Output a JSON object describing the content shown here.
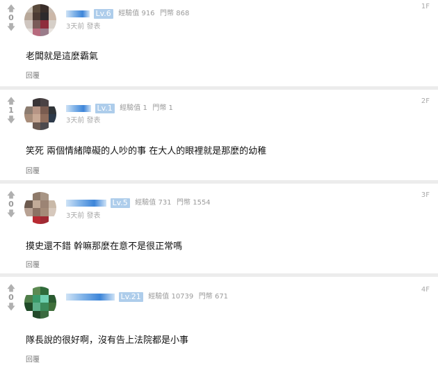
{
  "comments": [
    {
      "floor": "1F",
      "vote_count": "0",
      "level": "Lv.6",
      "exp": "經驗值 916",
      "coins": "門幣 868",
      "time": "3天前 發表",
      "text": "老闆就是這麼霸氣",
      "reply": "回覆",
      "avatar_colors": [
        "#c9c0b5",
        "#5a4a3c",
        "#3a2e2a",
        "#c7bbb0",
        "#b8a89a",
        "#4b3b33",
        "#2e2a2c",
        "#cbb7a8",
        "#cfc6c0",
        "#7a5b58",
        "#8e2d3c",
        "#d6cfc8",
        "#e4dfdb",
        "#b76a7d",
        "#9a7c8a",
        "#e9e4e0"
      ]
    },
    {
      "floor": "2F",
      "vote_count": "1",
      "level": "Lv.1",
      "exp": "經驗值 1",
      "coins": "門幣 1",
      "time": "3天前 發表",
      "text": "笑死 兩個情緒障礙的人吵的事 在大人的眼裡就是那麼的幼稚",
      "reply": "回覆",
      "avatar_colors": [
        "#ffffff",
        "#3a3537",
        "#4a4244",
        "#ffffff",
        "#8c7c70",
        "#b79585",
        "#7a5c50",
        "#303438",
        "#a88d7a",
        "#c8a995",
        "#8f6d5c",
        "#2d3a4a",
        "#ffffff",
        "#6b5a52",
        "#4c4a4e",
        "#ffffff"
      ]
    },
    {
      "floor": "3F",
      "vote_count": "0",
      "level": "Lv.5",
      "exp": "經驗值 731",
      "coins": "門幣 1554",
      "time": "3天前 發表",
      "text": "摸史還不錯 幹嘛那麼在意不是很正常嗎",
      "reply": "回覆",
      "avatar_colors": [
        "#ffffff",
        "#8e7a6a",
        "#a89585",
        "#ffffff",
        "#6d5a4e",
        "#c2ab98",
        "#9c8474",
        "#c9b9a8",
        "#b8a294",
        "#8b7364",
        "#a48b78",
        "#d6c8bc",
        "#ffffff",
        "#b82a32",
        "#a02a33",
        "#ffffff"
      ]
    },
    {
      "floor": "4F",
      "vote_count": "0",
      "level": "Lv.21",
      "exp": "經驗值 10739",
      "coins": "門幣 671",
      "time": "",
      "text": "隊長說的很好啊，沒有告上法院都是小事",
      "reply": "回覆",
      "avatar_colors": [
        "#ffffff",
        "#5c8a52",
        "#2f6b3a",
        "#ffffff",
        "#4f7e4a",
        "#3a9a6a",
        "#6fd0b0",
        "#2a5a30",
        "#1f4a28",
        "#5db08a",
        "#3a8a5a",
        "#3f6f3a",
        "#ffffff",
        "#244a2c",
        "#3b6a40",
        "#ffffff"
      ]
    }
  ],
  "colors": {
    "level_badge": "#aecdeb",
    "separator": "#ececec",
    "meta_text": "#9a9a9a"
  }
}
